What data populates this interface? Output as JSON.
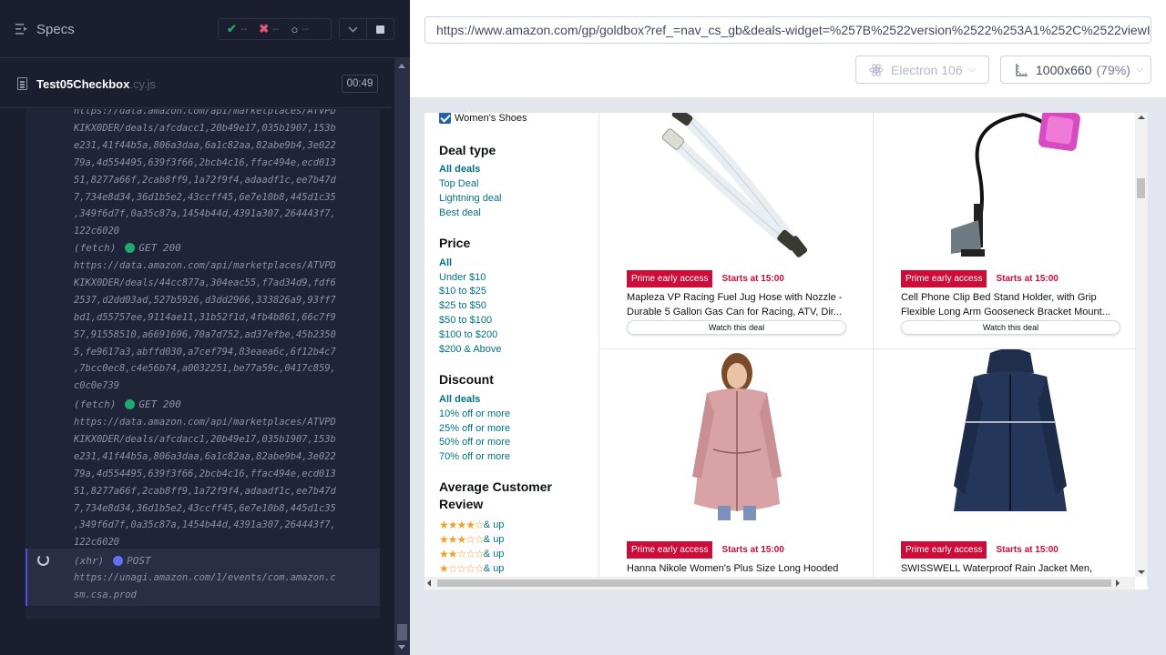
{
  "reporter": {
    "title": "Specs",
    "stats": {
      "passed": "--",
      "failed": "--",
      "pending": "--"
    },
    "file": {
      "name": "Test05Checkbox",
      "ext": ".cy.js",
      "duration": "00:49"
    },
    "logs": {
      "block1": [
        "https://data.amazon.com/api/marketplaces/ATVPD",
        "KIKX0DER/deals/afcdacc1,20b49e17,035b1907,153b",
        "e231,41f44b5a,806a3daa,6a1c82aa,82abe9b4,3e022",
        "79a,4d554495,639f3f66,2bcb4c16,ffac494e,ecd013",
        "51,8277a66f,2cab8ff9,1a72f9f4,adaadf1c,ee7b47d",
        "7,734e8d34,36d1b5e2,43ccff45,6e7e10b8,445d1c35",
        ",349f6d7f,0a35c87a,1454b44d,4391a307,264443f7,",
        "122c6020"
      ],
      "fetch1": {
        "type": "(fetch)",
        "method": "GET 200"
      },
      "block2": [
        "https://data.amazon.com/api/marketplaces/ATVPD",
        "KIKX0DER/deals/44cc877a,304eac55,f7ad34d9,fdf6",
        "2537,d2dd03ad,527b5926,d3dd2966,333826a9,93ff7",
        "bd1,d55757ee,9114ae11,31b52f1d,4fb4b861,66c7f9",
        "57,91558510,a6691696,70a7d752,ad37efbe,45b2350",
        "5,fe9617a3,abffd030,a7cef794,83eaea6c,6f12b4c7",
        ",7bcc0ec8,c4e56b74,a0032251,be77a59c,0417c859,",
        "c0c0e739"
      ],
      "fetch2": {
        "type": "(fetch)",
        "method": "GET 200"
      },
      "block3": [
        "https://data.amazon.com/api/marketplaces/ATVPD",
        "KIKX0DER/deals/afcdacc1,20b49e17,035b1907,153b",
        "e231,41f44b5a,806a3daa,6a1c82aa,82abe9b4,3e022",
        "79a,4d554495,639f3f66,2bcb4c16,ffac494e,ecd013",
        "51,8277a66f,2cab8ff9,1a72f9f4,adaadf1c,ee7b47d",
        "7,734e8d34,36d1b5e2,43ccff45,6e7e10b8,445d1c35",
        ",349f6d7f,0a35c87a,1454b44d,4391a307,264443f7,",
        "122c6020"
      ],
      "xhr": {
        "type": "(xhr)",
        "method": "POST",
        "lines": [
          "https://unagi.amazon.com/1/events/com.amazon.c",
          "sm.csa.prod"
        ]
      }
    }
  },
  "aut": {
    "url": "https://www.amazon.com/gp/goldbox?ref_=nav_cs_gb&deals-widget=%257B%2522version%2522%253A1%252C%2522viewI",
    "browser": "Electron 106",
    "viewport": "1000x660",
    "zoom": "(79%)"
  },
  "amazon": {
    "checkbox_label": "Women's Shoes",
    "deal_type": {
      "title": "Deal type",
      "items": [
        "All deals",
        "Top Deal",
        "Lightning deal",
        "Best deal"
      ]
    },
    "price": {
      "title": "Price",
      "items": [
        "All",
        "Under $10",
        "$10 to $25",
        "$25 to $50",
        "$50 to $100",
        "$100 to $200",
        "$200 & Above"
      ]
    },
    "discount": {
      "title": "Discount",
      "items": [
        "All deals",
        "10% off or more",
        "25% off or more",
        "50% off or more",
        "70% off or more"
      ]
    },
    "review": {
      "title_line1": "Average Customer",
      "title_line2": "Review",
      "suffix": "& up",
      "ratings": [
        4,
        3,
        2,
        1
      ]
    },
    "products": [
      {
        "badge": "Prime early access",
        "starts": "Starts at 15:00",
        "title_line1": "Mapleza VP Racing Fuel Jug Hose with Nozzle -",
        "title_line2": "Durable 5 Gallon Gas Can for Racing, ATV, Dir...",
        "watch": "Watch this deal"
      },
      {
        "badge": "Prime early access",
        "starts": "Starts at 15:00",
        "title_line1": "Cell Phone Clip Bed Stand Holder, with Grip",
        "title_line2": "Flexible Long Arm Gooseneck Bracket Mount...",
        "watch": "Watch this deal"
      },
      {
        "badge": "Prime early access",
        "starts": "Starts at 15:00",
        "title_line1": "Hanna Nikole Women's Plus Size Long Hooded"
      },
      {
        "badge": "Prime early access",
        "starts": "Starts at 15:00",
        "title_line1": "SWISSWELL Waterproof Rain Jacket Men,"
      }
    ]
  }
}
